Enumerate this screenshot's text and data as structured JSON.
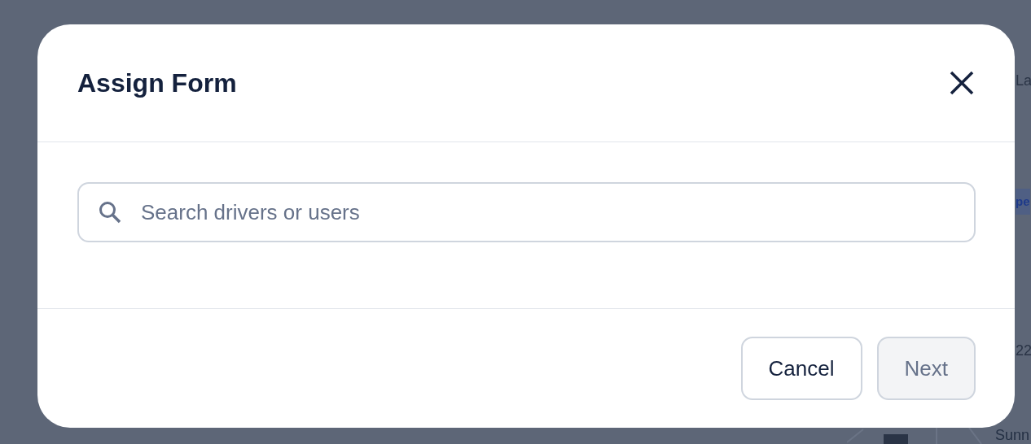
{
  "background_fragments": [
    {
      "text": "La",
      "kind": "text"
    },
    {
      "text": "pe",
      "kind": "highlight"
    },
    {
      "text": "22",
      "kind": "text"
    },
    {
      "text": "Sunn",
      "kind": "map-label"
    }
  ],
  "dialog": {
    "title": "Assign Form",
    "search": {
      "placeholder": "Search drivers or users"
    },
    "buttons": [
      {
        "label": "Cancel",
        "disabled": false
      },
      {
        "label": "Next",
        "disabled": true
      }
    ]
  }
}
